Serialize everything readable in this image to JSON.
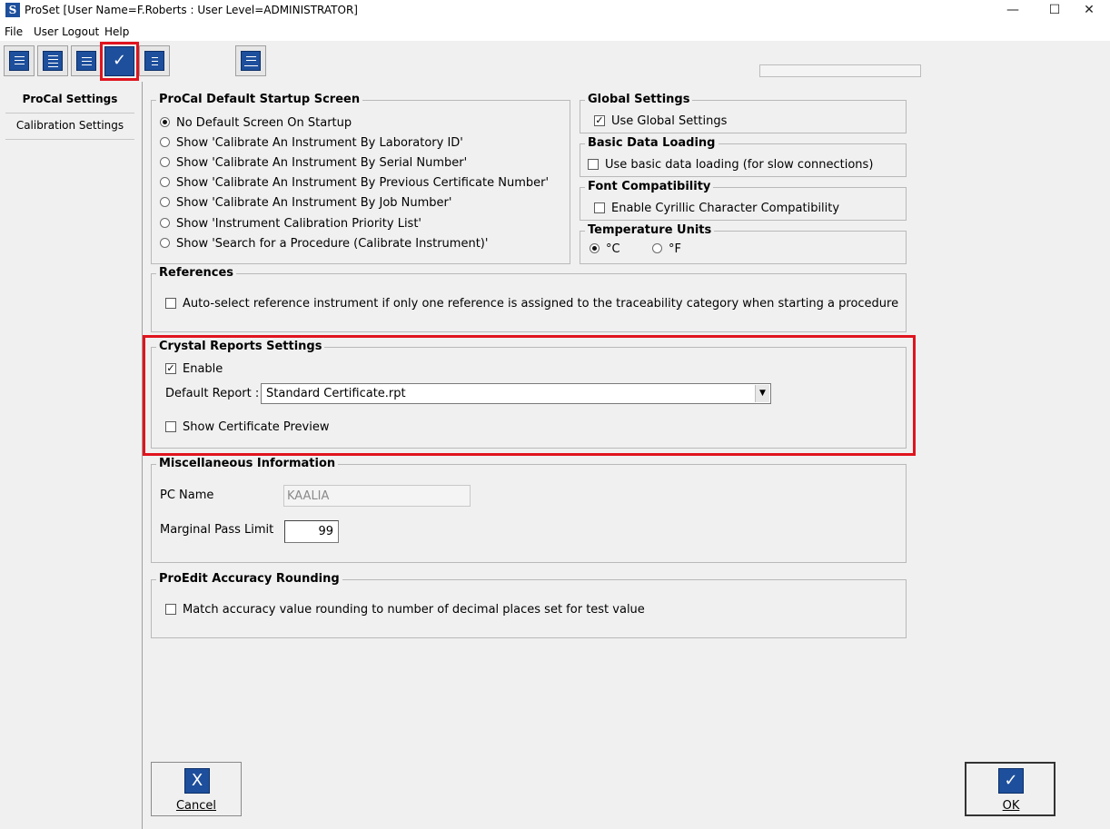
{
  "window": {
    "title": "ProSet [User Name=F.Roberts : User Level=ADMINISTRATOR]",
    "app_icon_letter": "S",
    "controls": {
      "minimize": "—",
      "maximize": "☐",
      "close": "✕"
    }
  },
  "menu": {
    "items": [
      "File",
      "User Logout",
      "Help"
    ]
  },
  "toolbar": {
    "buttons": [
      "monitor-list-icon",
      "list-icon",
      "documents-icon",
      "checkmark-icon",
      "document-icon",
      "print-preview-icon"
    ],
    "active_button": "checkmark-icon"
  },
  "sidebar": {
    "items": [
      "ProCal Settings",
      "Calibration Settings"
    ],
    "selected": "ProCal Settings"
  },
  "startup": {
    "title": "ProCal Default Startup Screen",
    "options": [
      "No Default Screen On Startup",
      "Show 'Calibrate An Instrument By Laboratory ID'",
      "Show 'Calibrate An Instrument By Serial Number'",
      "Show 'Calibrate An Instrument By Previous Certificate Number'",
      "Show 'Calibrate An Instrument By Job Number'",
      "Show 'Instrument Calibration Priority List'",
      "Show 'Search for a Procedure (Calibrate Instrument)'"
    ],
    "selected": "No Default Screen On Startup"
  },
  "global_settings": {
    "title": "Global Settings",
    "checkbox_label": "Use Global Settings",
    "checked": true
  },
  "basic_data": {
    "title": "Basic Data Loading",
    "checkbox_label": "Use basic data loading (for slow connections)",
    "checked": false
  },
  "font_compat": {
    "title": "Font Compatibility",
    "checkbox_label": "Enable Cyrillic Character Compatibility",
    "checked": false
  },
  "temperature": {
    "title": "Temperature Units",
    "options": [
      "°C",
      "°F"
    ],
    "selected": "°C"
  },
  "references": {
    "title": "References",
    "checkbox_label": "Auto-select reference instrument if only one reference is assigned to the traceability category when starting a procedure",
    "checked": false
  },
  "crystal": {
    "title": "Crystal Reports Settings",
    "enable_label": "Enable",
    "enable_checked": true,
    "default_report_label": "Default Report :",
    "default_report_value": "Standard Certificate.rpt",
    "preview_label": "Show Certificate Preview",
    "preview_checked": false
  },
  "misc": {
    "title": "Miscellaneous Information",
    "pc_name_label": "PC Name",
    "pc_name_value": "KAALIA",
    "marginal_label": "Marginal Pass Limit",
    "marginal_value": "99"
  },
  "proedit": {
    "title": "ProEdit Accuracy Rounding",
    "checkbox_label": "Match accuracy value rounding to number of decimal places set for test value",
    "checked": false
  },
  "buttons": {
    "cancel": "Cancel",
    "ok": "OK",
    "cancel_icon": "X",
    "ok_icon": "✓"
  },
  "colors": {
    "highlight": "#e0141e",
    "icon_blue": "#1d4f9c"
  }
}
